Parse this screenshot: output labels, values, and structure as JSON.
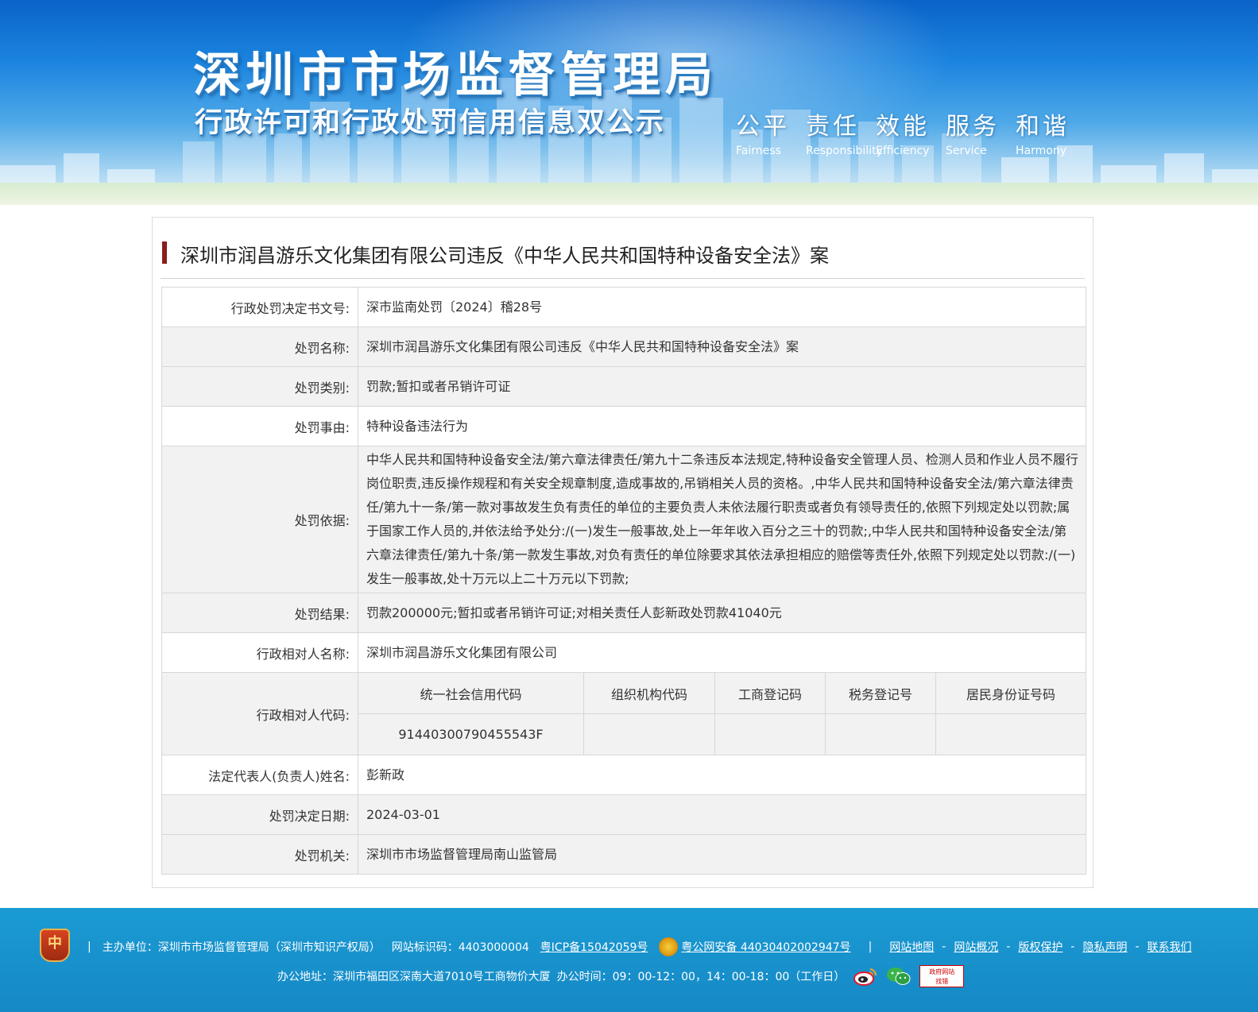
{
  "header": {
    "title": "深圳市市场监督管理局",
    "subtitle": "行政许可和行政处罚信用信息双公示",
    "slogans": [
      {
        "cn": "公平",
        "en": "Fairness"
      },
      {
        "cn": "责任",
        "en": "Responsibility"
      },
      {
        "cn": "效能",
        "en": "Efficiency"
      },
      {
        "cn": "服务",
        "en": "Service"
      },
      {
        "cn": "和谐",
        "en": "Harmony"
      }
    ]
  },
  "case_title": "深圳市润昌游乐文化集团有限公司违反《中华人民共和国特种设备安全法》案",
  "fields": {
    "decision_no": {
      "label": "行政处罚决定书文号:",
      "value": "深市监南处罚〔2024〕稽28号"
    },
    "penalty_name": {
      "label": "处罚名称:",
      "value": "深圳市润昌游乐文化集团有限公司违反《中华人民共和国特种设备安全法》案"
    },
    "penalty_type": {
      "label": "处罚类别:",
      "value": "罚款;暂扣或者吊销许可证"
    },
    "penalty_reason": {
      "label": "处罚事由:",
      "value": "特种设备违法行为"
    },
    "penalty_basis": {
      "label": "处罚依据:",
      "value": "中华人民共和国特种设备安全法/第六章法律责任/第九十二条违反本法规定,特种设备安全管理人员、检测人员和作业人员不履行岗位职责,违反操作规程和有关安全规章制度,造成事故的,吊销相关人员的资格。,中华人民共和国特种设备安全法/第六章法律责任/第九十一条/第一款对事故发生负有责任的单位的主要负责人未依法履行职责或者负有领导责任的,依照下列规定处以罚款;属于国家工作人员的,并依法给予处分:/(一)发生一般事故,处上一年年收入百分之三十的罚款;,中华人民共和国特种设备安全法/第六章法律责任/第九十条/第一款发生事故,对负有责任的单位除要求其依法承担相应的赔偿等责任外,依照下列规定处以罚款:/(一)发生一般事故,处十万元以上二十万元以下罚款;"
    },
    "penalty_result": {
      "label": "处罚结果:",
      "value": "罚款200000元;暂扣或者吊销许可证;对相关责任人彭新政处罚款41040元"
    },
    "party_name": {
      "label": "行政相对人名称:",
      "value": "深圳市润昌游乐文化集团有限公司"
    },
    "party_code": {
      "label": "行政相对人代码:",
      "headers": [
        "统一社会信用代码",
        "组织机构代码",
        "工商登记码",
        "税务登记号",
        "居民身份证号码"
      ],
      "values": [
        "91440300790455543F",
        "",
        "",
        "",
        ""
      ]
    },
    "legal_rep": {
      "label": "法定代表人(负责人)姓名:",
      "value": "彭新政"
    },
    "decision_date": {
      "label": "处罚决定日期:",
      "value": "2024-03-01"
    },
    "authority": {
      "label": "处罚机关:",
      "value": "深圳市市场监督管理局南山监管局"
    }
  },
  "footer": {
    "emblem_text": "中",
    "divider": "|",
    "sponsor": "主办单位：深圳市市场监督管理局（深圳市知识产权局）",
    "site_id": "网站标识码：4403000004",
    "icp": "粤ICP备15042059号",
    "police_record": "粤公网安备 44030402002947号",
    "links": [
      "网站地图",
      "网站概况",
      "版权保护",
      "隐私声明",
      "联系我们"
    ],
    "link_separator": "-",
    "address": "办公地址：深圳市福田区深南大道7010号工商物价大厦",
    "hours": "办公时间：09：00-12：00，14：00-18：00（工作日）",
    "gov_badge": [
      "政府网站",
      "找错"
    ],
    "icons": [
      "weibo-icon",
      "wechat-icon",
      "gov-website-badge-icon",
      "police-badge-icon",
      "emblem-icon"
    ]
  }
}
